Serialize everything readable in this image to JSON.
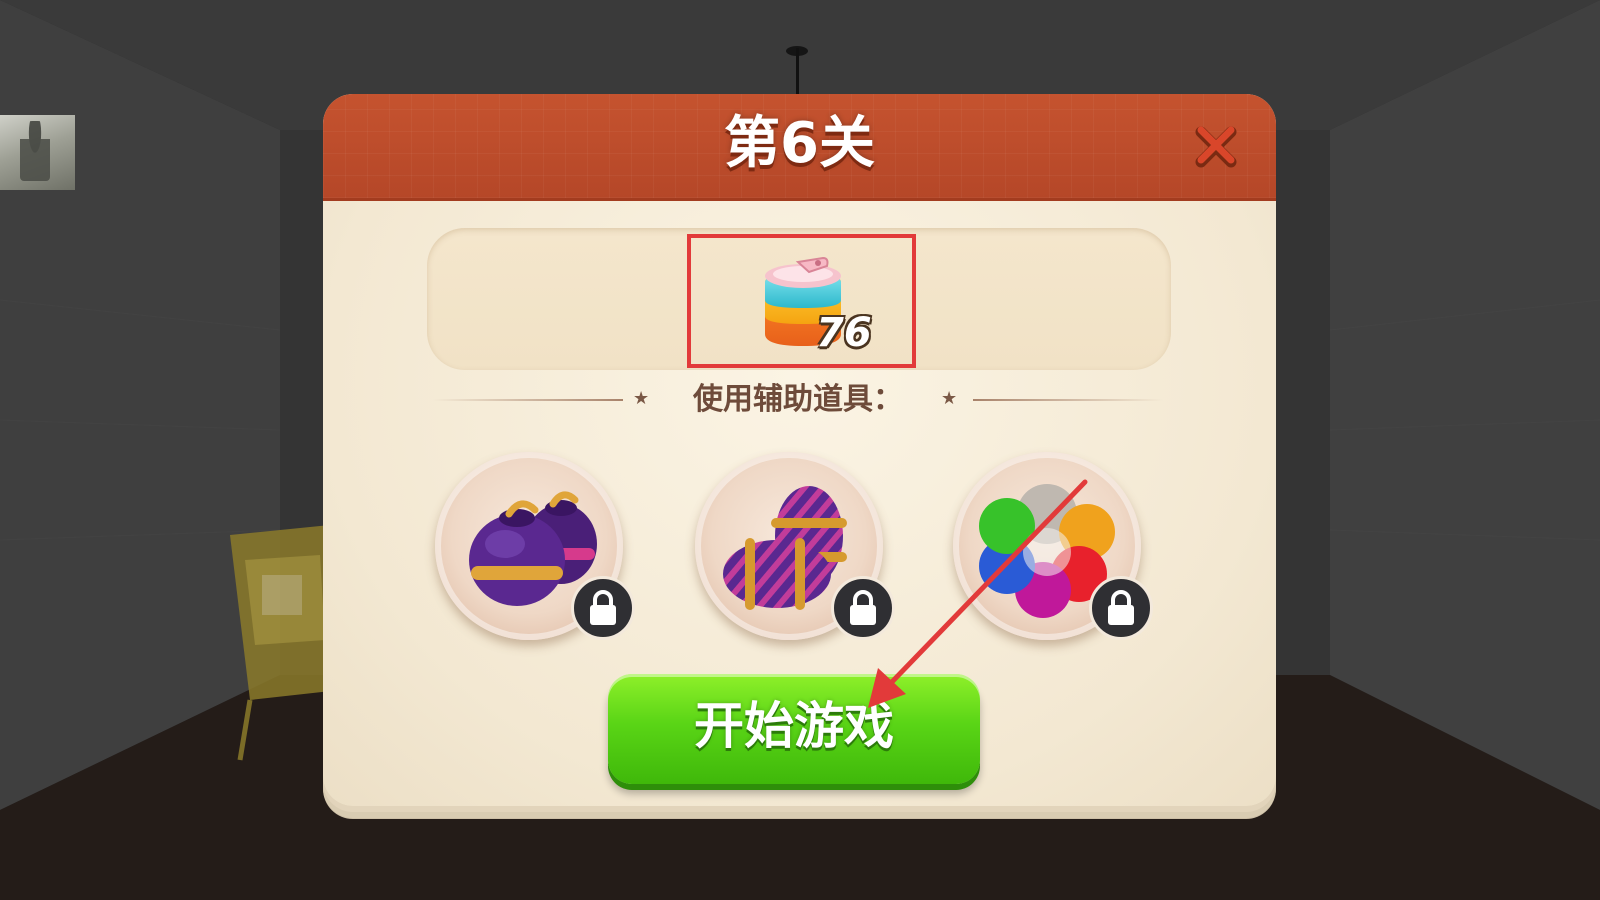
{
  "level": {
    "title": "第6关"
  },
  "target": {
    "item_icon": "paint-can-icon",
    "count": "76"
  },
  "boosters": {
    "label": "使用辅助道具：",
    "items": [
      {
        "icon": "bomb-booster-icon",
        "locked": true
      },
      {
        "icon": "striped-candy-booster-icon",
        "locked": true
      },
      {
        "icon": "rainbow-ball-booster-icon",
        "locked": true
      }
    ]
  },
  "start_button": {
    "label": "开始游戏"
  },
  "colors": {
    "header": "#c5532f",
    "highlight": "#e23a3a",
    "start_green": "#5ad516",
    "arrow": "#e23a3a"
  }
}
